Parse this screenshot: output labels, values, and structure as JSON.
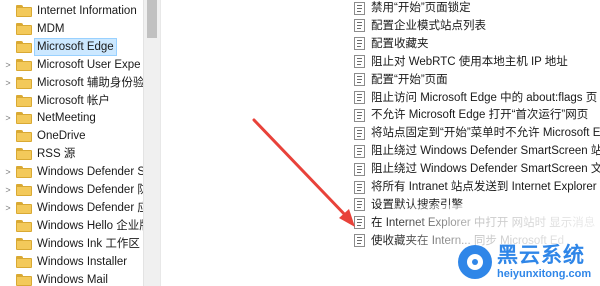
{
  "tree": {
    "items": [
      {
        "label": "Internet Information",
        "expander": "",
        "selected": false
      },
      {
        "label": "MDM",
        "expander": "",
        "selected": false
      },
      {
        "label": "Microsoft Edge",
        "expander": "",
        "selected": true
      },
      {
        "label": "Microsoft User Expe",
        "expander": ">",
        "selected": false
      },
      {
        "label": "Microsoft 辅助身份验",
        "expander": ">",
        "selected": false
      },
      {
        "label": "Microsoft 帐户",
        "expander": "",
        "selected": false
      },
      {
        "label": "NetMeeting",
        "expander": ">",
        "selected": false
      },
      {
        "label": "OneDrive",
        "expander": "",
        "selected": false
      },
      {
        "label": "RSS 源",
        "expander": "",
        "selected": false
      },
      {
        "label": "Windows Defender S",
        "expander": ">",
        "selected": false
      },
      {
        "label": "Windows Defender 防",
        "expander": ">",
        "selected": false
      },
      {
        "label": "Windows Defender 应",
        "expander": ">",
        "selected": false
      },
      {
        "label": "Windows Hello 企业版",
        "expander": "",
        "selected": false
      },
      {
        "label": "Windows Ink 工作区",
        "expander": "",
        "selected": false
      },
      {
        "label": "Windows Installer",
        "expander": "",
        "selected": false
      },
      {
        "label": "Windows Mail",
        "expander": "",
        "selected": false
      }
    ]
  },
  "settings": {
    "items": [
      {
        "label": "禁用“开始”页面锁定"
      },
      {
        "label": "配置企业模式站点列表"
      },
      {
        "label": "配置收藏夹"
      },
      {
        "label": "阻止对 WebRTC 使用本地主机 IP 地址"
      },
      {
        "label": "配置“开始”页面"
      },
      {
        "label": "阻止访问 Microsoft Edge 中的 about:flags 页"
      },
      {
        "label": "不允许 Microsoft Edge 打开“首次运行”网页"
      },
      {
        "label": "将站点固定到“开始”菜单时不允许 Microsoft Ed"
      },
      {
        "label": "阻止绕过 Windows Defender SmartScreen 站"
      },
      {
        "label": "阻止绕过 Windows Defender SmartScreen 文"
      },
      {
        "label": "将所有 Intranet 站点发送到 Internet Explorer"
      },
      {
        "label": "设置默认搜索引擎"
      },
      {
        "label": "在 Internet Explorer 中打开 网站时 显示消息"
      },
      {
        "label": "使收藏夹在 Intern... 同步 Microsoft Ed"
      }
    ]
  },
  "watermark": {
    "title": "黑云系统",
    "url": "heiyunxitong.com"
  },
  "colors": {
    "selection": "#cce8ff",
    "arrow": "#e8423a",
    "watermark": "#2f86e8",
    "folder": "#f3c95a"
  }
}
